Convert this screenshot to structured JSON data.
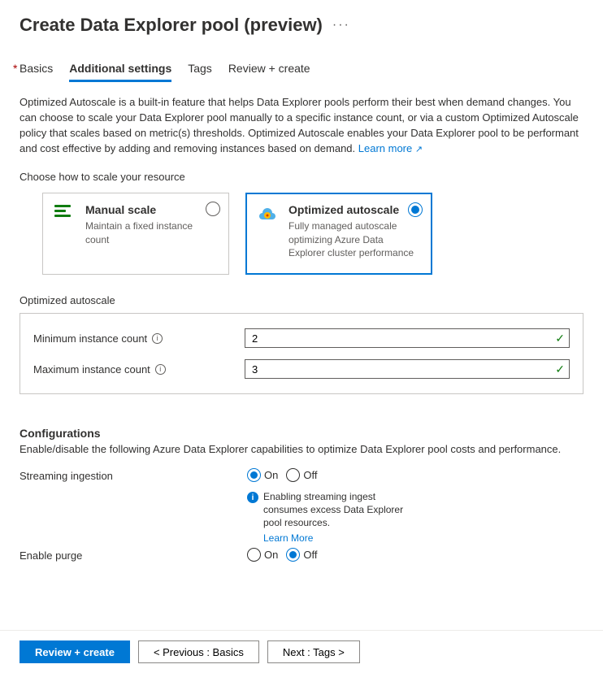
{
  "header": {
    "title": "Create Data Explorer pool (preview)"
  },
  "tabs": {
    "basics": "Basics",
    "additional": "Additional settings",
    "tags": "Tags",
    "review": "Review + create"
  },
  "description": "Optimized Autoscale is a built-in feature that helps Data Explorer pools perform their best when demand changes. You can choose to scale your Data Explorer pool manually to a specific instance count, or via a custom Optimized Autoscale policy that scales based on metric(s) thresholds. Optimized Autoscale enables your Data Explorer pool to be performant and cost effective by adding and removing instances based on demand. ",
  "learn_more": "Learn more",
  "scale": {
    "label": "Choose how to scale your resource",
    "manual": {
      "title": "Manual scale",
      "sub": "Maintain a fixed instance count"
    },
    "optimized": {
      "title": "Optimized autoscale",
      "sub": "Fully managed autoscale optimizing Azure Data Explorer cluster performance"
    }
  },
  "autoscale": {
    "header": "Optimized autoscale",
    "min_label": "Minimum instance count",
    "min_value": "2",
    "max_label": "Maximum instance count",
    "max_value": "3"
  },
  "config": {
    "header": "Configurations",
    "desc": "Enable/disable the following Azure Data Explorer capabilities to optimize Data Explorer pool costs and performance.",
    "streaming_label": "Streaming ingestion",
    "purge_label": "Enable purge",
    "on": "On",
    "off": "Off",
    "info_text": "Enabling streaming ingest consumes excess Data Explorer pool resources.",
    "info_link": "Learn More"
  },
  "footer": {
    "review": "Review + create",
    "prev": "< Previous : Basics",
    "next": "Next : Tags >"
  }
}
